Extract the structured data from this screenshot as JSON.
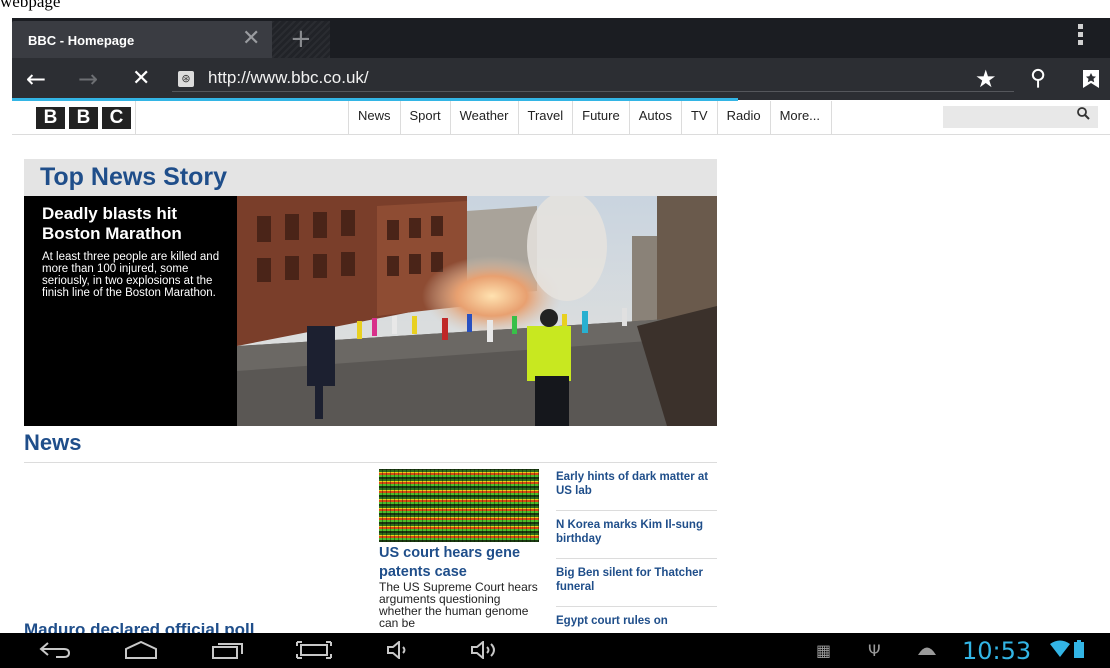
{
  "caption": "webpage",
  "browser": {
    "tab_title": "BBC - Homepage",
    "url": "http://www.bbc.co.uk/"
  },
  "bbc_nav": {
    "logo_letters": [
      "B",
      "B",
      "C"
    ],
    "items": [
      "News",
      "Sport",
      "Weather",
      "Travel",
      "Future",
      "Autos",
      "TV",
      "Radio",
      "More..."
    ]
  },
  "top_story": {
    "section_title": "Top News Story",
    "headline": "Deadly blasts hit Boston Marathon",
    "summary": "At least three people are killed and more than 100 injured, some seriously, in two explosions at the finish line of the Boston Marathon."
  },
  "news": {
    "section_title": "News",
    "feature_headline": "US court hears gene patents case",
    "feature_summary": "The US Supreme Court hears arguments questioning whether the human genome can be",
    "cut_headline": "Maduro declared official poll",
    "headlines": [
      "Early hints of dark matter at US lab",
      "N Korea marks Kim Il-sung birthday",
      "Big Ben silent for Thatcher funeral",
      "Egypt court rules on"
    ]
  },
  "status_bar": {
    "time": "10:53"
  },
  "icons": {
    "back": "arrow-left-icon",
    "forward": "arrow-right-icon",
    "stop": "close-icon",
    "bookmark": "star-icon",
    "search": "search-icon",
    "bookmarks_list": "bookmark-icon"
  }
}
